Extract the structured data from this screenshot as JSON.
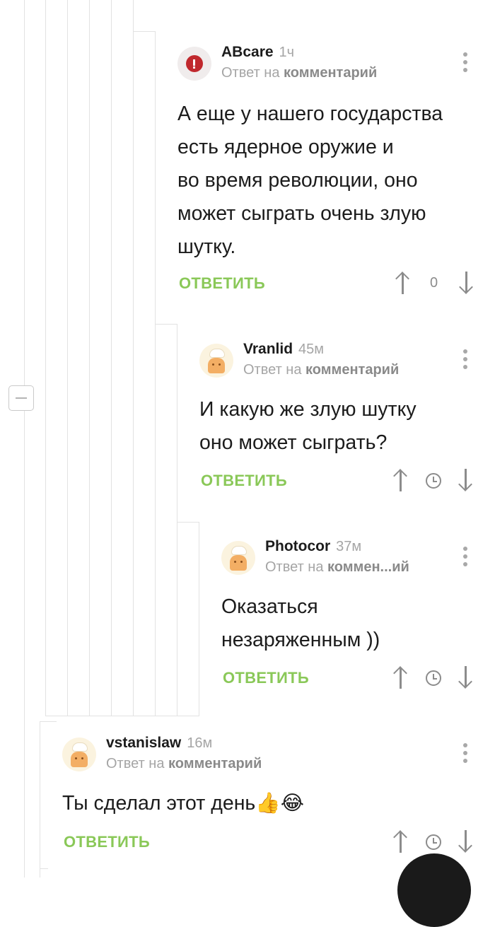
{
  "comments": [
    {
      "author": "ABcare",
      "time": "1ч",
      "reply_prefix": "Ответ на",
      "reply_target": "комментарий",
      "text": "А еще у нашего государства\nесть ядерное оружие и\nво время революции, оно\nможет сыграть очень злую\nшутку.",
      "reply_label": "ОТВЕТИТЬ",
      "score": "0",
      "avatar": "red-warning-avatar"
    },
    {
      "author": "Vranlid",
      "time": "45м",
      "reply_prefix": "Ответ на",
      "reply_target": "комментарий",
      "text": "И какую же злую шутку\nоно может сыграть?",
      "reply_label": "ОТВЕТИТЬ",
      "avatar": "chef-avatar"
    },
    {
      "author": "Photocor",
      "time": "37м",
      "reply_prefix": "Ответ на",
      "reply_target": "коммен...ий",
      "text": "Оказаться\nнезаряженным ))",
      "reply_label": "ОТВЕТИТЬ",
      "avatar": "chef-avatar"
    },
    {
      "author": "vstanislaw",
      "time": "16м",
      "reply_prefix": "Ответ на",
      "reply_target": "комментарий",
      "text": "Ты сделал этот день👍😂",
      "reply_label": "ОТВЕТИТЬ",
      "avatar": "chef-avatar"
    }
  ],
  "colors": {
    "reply_green": "#8ac858",
    "muted_grey": "#a5a5a5",
    "thread_line": "#e2e2e2"
  }
}
